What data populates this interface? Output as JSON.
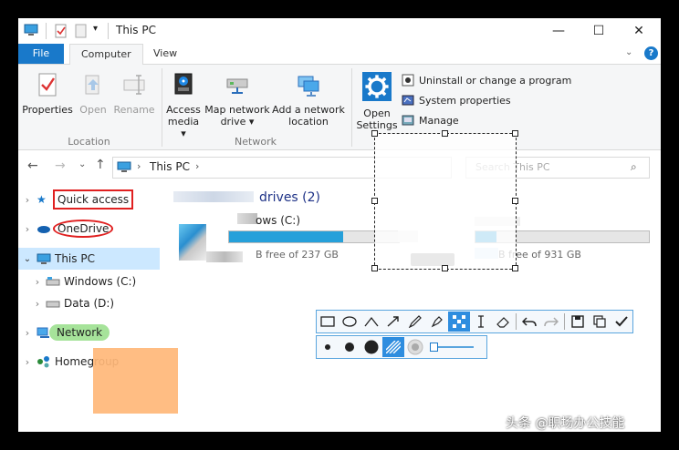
{
  "window": {
    "title": "This PC",
    "controls": [
      "—",
      "☐",
      "✕"
    ]
  },
  "tabs": [
    {
      "label": "File"
    },
    {
      "label": "Computer"
    },
    {
      "label": "View"
    }
  ],
  "ribbon": {
    "location": {
      "group": "Location",
      "buttons": [
        {
          "label": "Properties"
        },
        {
          "label": "Open"
        },
        {
          "label": "Rename"
        }
      ]
    },
    "network": {
      "group": "Network",
      "access_media": [
        "Access",
        "media ▾"
      ],
      "map_drive": [
        "Map network",
        "drive ▾"
      ],
      "add_location": [
        "Add a network",
        "location"
      ]
    },
    "system": {
      "open_settings": [
        "Open",
        "Settings"
      ],
      "uninstall": "Uninstall or change a program",
      "sys_props": "System properties",
      "manage": "Manage"
    }
  },
  "address": {
    "path": "This PC",
    "search_placeholder": "Search This PC"
  },
  "nav": [
    {
      "label": "Quick access"
    },
    {
      "label": "OneDrive"
    },
    {
      "label": "This PC"
    },
    {
      "label": "Windows (C:)"
    },
    {
      "label": "Data (D:)"
    },
    {
      "label": "Network"
    },
    {
      "label": "Homegroup"
    }
  ],
  "content": {
    "section": "drives (2)",
    "drives": [
      {
        "name": "ows (C:)",
        "free": "B free of 237 GB",
        "fill": 0.67
      },
      {
        "name": "",
        "free": "B free of 931 GB",
        "fill": 0.12
      }
    ]
  },
  "watermark": "头条 @职场办公技能",
  "colors": {
    "accent": "#1979ca",
    "bar_fill": "#26a0da",
    "selection_red": "#e02020",
    "network_highlight": "#a6e39a",
    "orange_rect": "#ffb778"
  }
}
